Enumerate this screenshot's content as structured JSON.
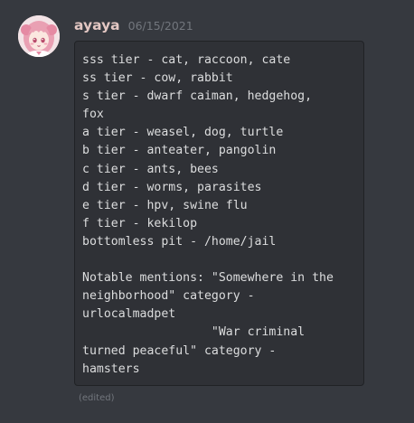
{
  "message": {
    "author": "ayaya",
    "timestamp": "06/15/2021",
    "code_lines": [
      "sss tier - cat, raccoon, cate",
      "ss tier - cow, rabbit",
      "s tier - dwarf caiman, hedgehog,",
      "fox",
      "a tier - weasel, dog, turtle",
      "b tier - anteater, pangolin",
      "c tier - ants, bees",
      "d tier - worms, parasites",
      "e tier - hpv, swine flu",
      "f tier - kekilop",
      "bottomless pit - /home/jail",
      "",
      "Notable mentions: \"Somewhere in the",
      "neighborhood\" category -",
      "urlocalmadpet",
      "                  \"War criminal",
      "turned peaceful\" category -",
      "hamsters"
    ],
    "edited_label": "(edited)"
  },
  "avatar": {
    "icon": "anime-girl-avatar-icon",
    "hair_color": "#e9a0b3",
    "background_color": "#f3e3e6"
  },
  "colors": {
    "background": "#36393f",
    "codeblock_background": "#2f3136",
    "username": "#e3c7c3",
    "muted_text": "#72767d",
    "code_text": "#dcddde"
  }
}
